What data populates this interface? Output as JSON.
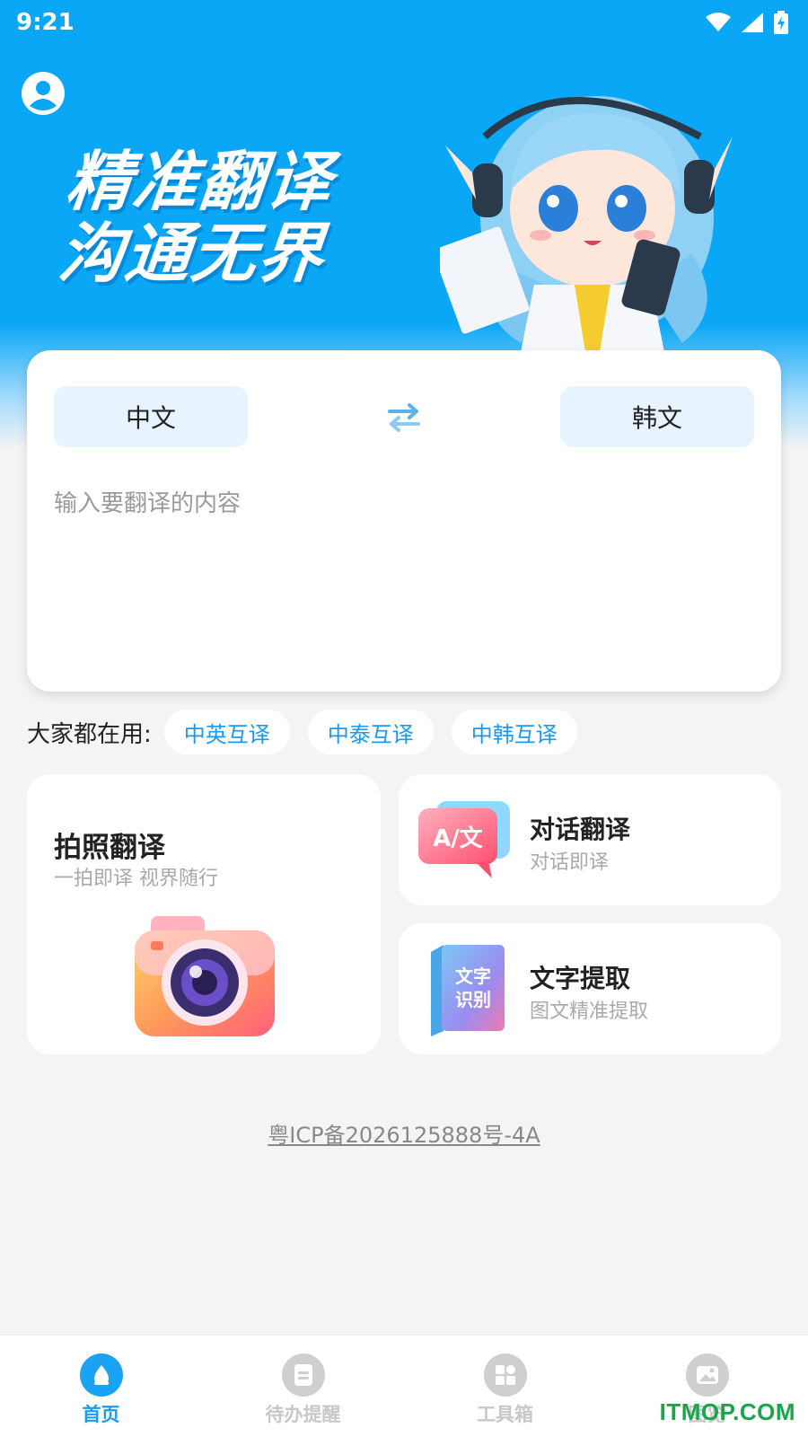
{
  "status_bar": {
    "time": "9:21"
  },
  "hero": {
    "slogan_line1": "精准翻译",
    "slogan_line2": "沟通无界"
  },
  "translator": {
    "source_language": "中文",
    "target_language": "韩文",
    "input_placeholder": "输入要翻译的内容"
  },
  "popular": {
    "label": "大家都在用:",
    "chips": [
      "中英互译",
      "中泰互译",
      "中韩互译"
    ]
  },
  "features": {
    "photo": {
      "title": "拍照翻译",
      "subtitle": "一拍即译 视界随行"
    },
    "dialog": {
      "title": "对话翻译",
      "subtitle": "对话即译",
      "icon_text": "A/文"
    },
    "ocr": {
      "title": "文字提取",
      "subtitle": "图文精准提取",
      "icon_text_1": "文字",
      "icon_text_2": "识别"
    }
  },
  "footer": {
    "icp": "粤ICP备2026125888号-4A"
  },
  "bottom_nav": {
    "items": [
      {
        "label": "首页",
        "icon": "home-icon",
        "active": true
      },
      {
        "label": "待办提醒",
        "icon": "todo-icon",
        "active": false
      },
      {
        "label": "工具箱",
        "icon": "toolbox-icon",
        "active": false
      },
      {
        "label": "图览",
        "icon": "gallery-icon",
        "active": false
      }
    ]
  },
  "watermark": "ITMOP.COM",
  "colors": {
    "brand_blue": "#0aa7f6",
    "chip_text": "#1a9bf0",
    "watermark_green": "#19a64a"
  }
}
